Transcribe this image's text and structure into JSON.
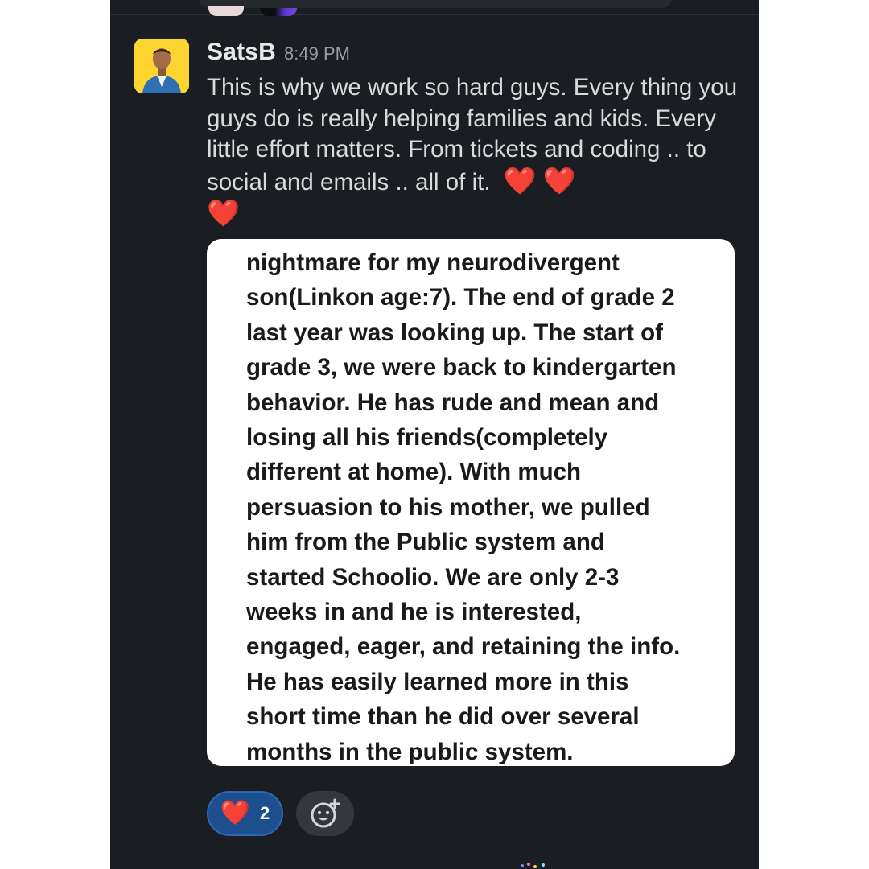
{
  "message": {
    "author": "SatsB",
    "timestamp": "8:49 PM",
    "body": "This is why we work so hard guys. Every thing you guys do is really helping families and kids. Every little effort matters. From tickets and coding .. to social and emails .. all of it.",
    "heart_emoji": "❤️"
  },
  "attachment": {
    "lines": [
      "nightmare for my neurodivergent",
      "son(Linkon age:7). The end of grade 2",
      "last year was looking up. The start of",
      "grade 3, we were back to kindergarten",
      "behavior. He has rude and mean and",
      "losing all his friends(completely",
      "different at home). With much",
      "persuasion to his mother, we pulled",
      "him from the Public system and",
      "started Schoolio. We are only 2-3",
      "weeks in and he is interested,",
      "engaged, eager, and retaining the info.",
      "He has easily learned more in this",
      "short time than he did over several",
      "months in the public system."
    ]
  },
  "reactions": [
    {
      "emoji": "❤️",
      "count": "2",
      "selected": true
    }
  ],
  "icons": {
    "add_reaction": "add-reaction-icon"
  },
  "colors": {
    "background": "#1a1d21",
    "reaction_selected": "#1d4f8f",
    "avatar_bg": "#fcd530"
  }
}
